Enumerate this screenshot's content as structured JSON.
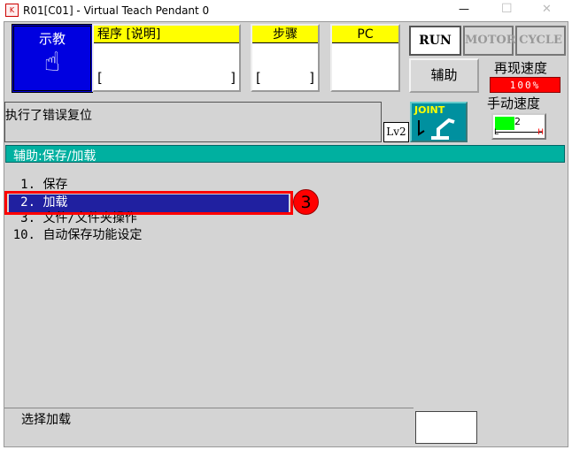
{
  "window": {
    "title": "R01[C01] - Virtual Teach Pendant 0",
    "minimize": "—",
    "maximize": "☐",
    "close": "✕"
  },
  "mode": {
    "label": "示教",
    "icon": "hand-pointer-icon",
    "color": "#0000e0"
  },
  "program": {
    "label": "程序 [说明]",
    "value": "[",
    "value_end": "]"
  },
  "step": {
    "label": "步骤",
    "value": "[",
    "value_end": "]"
  },
  "pc": {
    "label": "PC"
  },
  "status": {
    "run": "RUN",
    "motor": "MOTOR",
    "cycle": "CYCLE"
  },
  "aux_button": "辅助",
  "replay_speed": {
    "label": "再现速度",
    "value": "100%",
    "color": "#ff0000"
  },
  "manual_speed": {
    "label": "手动速度",
    "value": "2",
    "low": "L",
    "high": "H",
    "level": 2,
    "max": 5
  },
  "message": "执行了错误复位",
  "level": "Lv2",
  "coord": {
    "label": "JOINT"
  },
  "section_title": "辅助:保存/加载",
  "menu": [
    {
      "num": "1.",
      "label": "保存"
    },
    {
      "num": "2.",
      "label": "加载",
      "selected": true
    },
    {
      "num": "3.",
      "label": "文件/文件夹操作"
    },
    {
      "num": "10.",
      "label": "自动保存功能设定"
    }
  ],
  "annotation": "3",
  "footer": {
    "hint": "选择加载"
  }
}
